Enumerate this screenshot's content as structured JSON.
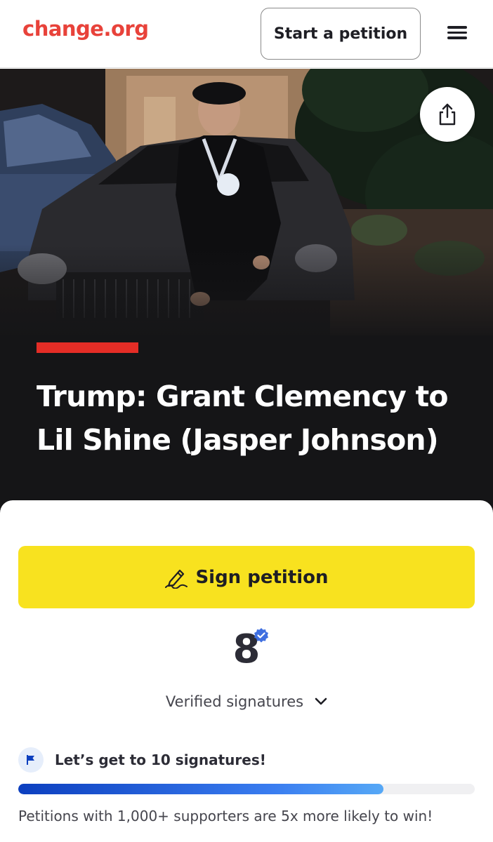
{
  "header": {
    "logo": "change.org",
    "start_button": "Start a petition",
    "menu_icon": "hamburger-menu-icon"
  },
  "hero": {
    "share_icon": "share-icon",
    "title": "Trump: Grant Clemency to Lil Shine (Jasper Johnson)",
    "accent_color": "#e42d26"
  },
  "petition": {
    "sign_button": "Sign petition",
    "sign_icon": "pen-signature-icon",
    "signature_count": "8",
    "verified_icon": "verified-check-icon",
    "verified_label": "Verified signatures",
    "goal_text": "Let’s get to 10 signatures!",
    "goal_icon": "flag-icon",
    "progress_fraction": 0.8,
    "footnote": "Petitions with 1,000+ supporters are 5x more likely to win!"
  },
  "colors": {
    "brand": "#e8423a",
    "sign_button": "#f8e21f",
    "progress": "#2f6fe8",
    "verified": "#3f6fe0"
  }
}
